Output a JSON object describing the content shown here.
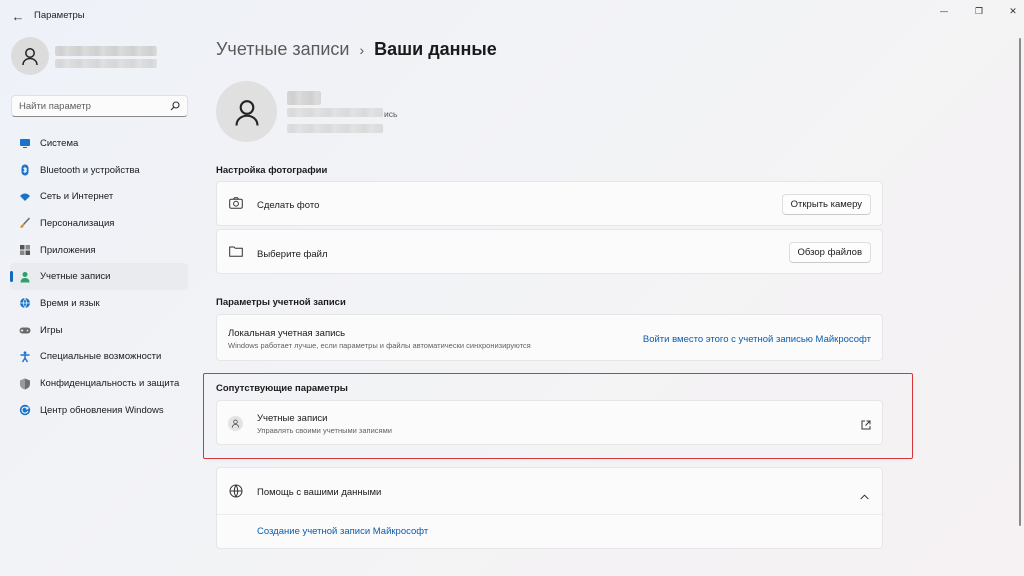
{
  "window": {
    "title": "Параметры",
    "back_glyph": "←",
    "min_glyph": "—",
    "max_glyph": "❐",
    "close_glyph": "✕"
  },
  "search": {
    "placeholder": "Найти параметр"
  },
  "sidebar": {
    "items": [
      {
        "label": "Система",
        "icon": "monitor-icon",
        "color": "#1a73c7"
      },
      {
        "label": "Bluetooth и устройства",
        "icon": "bluetooth-icon",
        "color": "#1a73c7"
      },
      {
        "label": "Сеть и Интернет",
        "icon": "wifi-icon",
        "color": "#1a73c7"
      },
      {
        "label": "Персонализация",
        "icon": "brush-icon",
        "color": "#e08a2c"
      },
      {
        "label": "Приложения",
        "icon": "apps-icon",
        "color": "#555555"
      },
      {
        "label": "Учетные записи",
        "icon": "person-icon",
        "color": "#2aa36b",
        "active": true
      },
      {
        "label": "Время и язык",
        "icon": "globe-clock-icon",
        "color": "#1a73c7"
      },
      {
        "label": "Игры",
        "icon": "gamepad-icon",
        "color": "#666666"
      },
      {
        "label": "Специальные возможности",
        "icon": "accessibility-icon",
        "color": "#1a73c7"
      },
      {
        "label": "Конфиденциальность и защита",
        "icon": "shield-icon",
        "color": "#666666"
      },
      {
        "label": "Центр обновления Windows",
        "icon": "update-icon",
        "color": "#1a73c7"
      }
    ]
  },
  "breadcrumb": {
    "parent": "Учетные записи",
    "separator": "›",
    "current": "Ваши данные"
  },
  "account": {
    "type_tail": "ись"
  },
  "photo_section": {
    "title": "Настройка фотографии",
    "take_photo_label": "Сделать фото",
    "open_camera_button": "Открыть камеру",
    "choose_file_label": "Выберите файл",
    "browse_button": "Обзор файлов"
  },
  "account_settings": {
    "title": "Параметры учетной записи",
    "local_label": "Локальная учетная запись",
    "local_desc": "Windows работает лучше, если параметры и файлы автоматически синхронизируются",
    "ms_link": "Войти вместо этого с учетной записью Майкрософт"
  },
  "related": {
    "title": "Сопутствующие параметры",
    "item_title": "Учетные записи",
    "item_desc": "Управлять своими учетными записями"
  },
  "help": {
    "title": "Помощь с вашими данными",
    "link": "Создание учетной записи Майкрософт"
  },
  "colors": {
    "accent": "#0f6cbd",
    "highlight": "#d9353a"
  }
}
